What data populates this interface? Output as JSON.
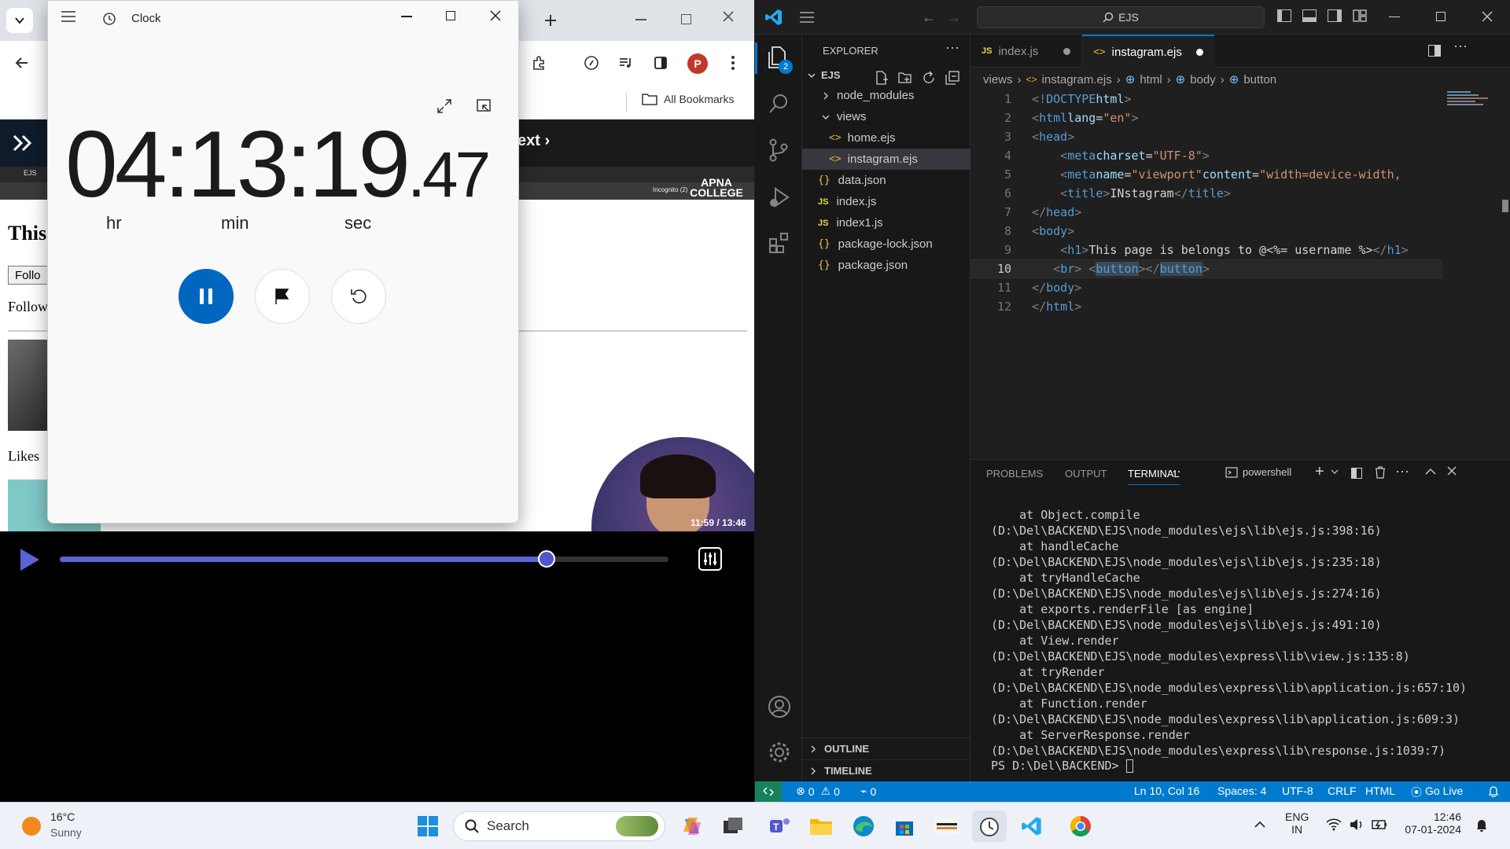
{
  "browser": {
    "bookmarks_label": "All Bookmarks",
    "profile_initial": "P",
    "page_heading_partial": "This",
    "follow_button_partial": "Follo",
    "followers_partial": "Follow",
    "likes_partial": "Likes",
    "next_link": "ext ›",
    "embedded_tab": "EJS",
    "embedded_incognito": "Incognito (2)",
    "watermark": "APNA COLLEGE",
    "video_time": "11:59 / 13:46",
    "video_progress": 0.8
  },
  "clock": {
    "title": "Clock",
    "hours": "04",
    "minutes": "13",
    "seconds": "19",
    "hundredths": ".47",
    "hr_label": "hr",
    "min_label": "min",
    "sec_label": "sec",
    "accent": "#0067c0"
  },
  "vscode": {
    "search": "EJS",
    "explorer_title": "EXPLORER",
    "root_folder": "EJS",
    "files": [
      {
        "name": "node_modules",
        "kind": "folder"
      },
      {
        "name": "views",
        "kind": "folder-open"
      },
      {
        "name": "home.ejs",
        "kind": "ejs"
      },
      {
        "name": "instagram.ejs",
        "kind": "ejs"
      },
      {
        "name": "data.json",
        "kind": "json"
      },
      {
        "name": "index.js",
        "kind": "js"
      },
      {
        "name": "index1.js",
        "kind": "js"
      },
      {
        "name": "package-lock.json",
        "kind": "json"
      },
      {
        "name": "package.json",
        "kind": "json"
      }
    ],
    "outline": "OUTLINE",
    "timeline": "TIMELINE",
    "badge": "2",
    "tabs": [
      {
        "label": "index.js",
        "icon": "JS"
      },
      {
        "label": "instagram.ejs",
        "icon": "<>"
      }
    ],
    "breadcrumb": [
      "views",
      "instagram.ejs",
      "html",
      "body",
      "button"
    ],
    "panel_tabs": [
      "PROBLEMS",
      "OUTPUT",
      "TERMINAL"
    ],
    "terminal_shell": "powershell",
    "terminal_lines": [
      "    at Object.compile (D:\\Del\\BACKEND\\EJS\\node_modules\\ejs\\lib\\ejs.js:398:16)",
      "    at handleCache (D:\\Del\\BACKEND\\EJS\\node_modules\\ejs\\lib\\ejs.js:235:18)",
      "    at tryHandleCache (D:\\Del\\BACKEND\\EJS\\node_modules\\ejs\\lib\\ejs.js:274:16)",
      "    at exports.renderFile [as engine] (D:\\Del\\BACKEND\\EJS\\node_modules\\ejs\\lib\\ejs.js:491:10)",
      "    at View.render (D:\\Del\\BACKEND\\EJS\\node_modules\\express\\lib\\view.js:135:8)",
      "    at tryRender (D:\\Del\\BACKEND\\EJS\\node_modules\\express\\lib\\application.js:657:10)",
      "    at Function.render (D:\\Del\\BACKEND\\EJS\\node_modules\\express\\lib\\application.js:609:3)",
      "    at ServerResponse.render (D:\\Del\\BACKEND\\EJS\\node_modules\\express\\lib\\response.js:1039:7)",
      "PS D:\\Del\\BACKEND> "
    ],
    "status": {
      "errors": "0",
      "warnings": "0",
      "ports": "0",
      "position": "Ln 10, Col 16",
      "spaces": "Spaces: 4",
      "encoding": "UTF-8",
      "eol": "CRLF",
      "language": "HTML",
      "golive": "Go Live"
    }
  },
  "taskbar": {
    "temp": "16°C",
    "weather": "Sunny",
    "search_placeholder": "Search",
    "lang_top": "ENG",
    "lang_bottom": "IN",
    "time": "12:46",
    "date": "07-01-2024"
  }
}
